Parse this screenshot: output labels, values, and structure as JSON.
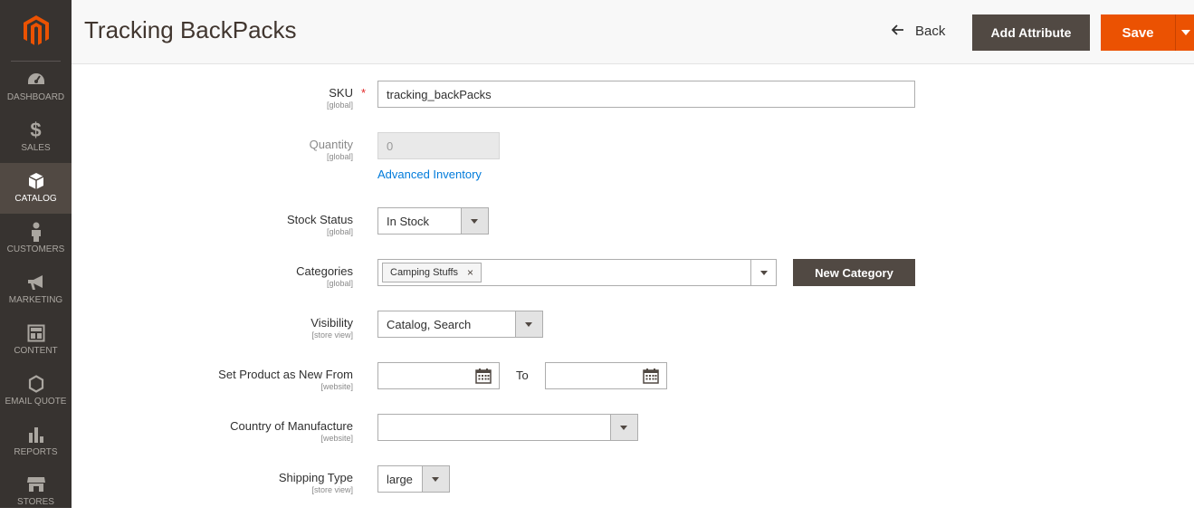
{
  "nav": {
    "items": [
      {
        "label": "DASHBOARD",
        "icon": "dashboard-icon"
      },
      {
        "label": "SALES",
        "icon": "dollar-icon"
      },
      {
        "label": "CATALOG",
        "icon": "box-icon"
      },
      {
        "label": "CUSTOMERS",
        "icon": "person-icon"
      },
      {
        "label": "MARKETING",
        "icon": "megaphone-icon"
      },
      {
        "label": "CONTENT",
        "icon": "layout-icon"
      },
      {
        "label": "EMAIL QUOTE",
        "icon": "hexagon-icon"
      },
      {
        "label": "REPORTS",
        "icon": "bar-chart-icon"
      },
      {
        "label": "STORES",
        "icon": "store-icon"
      }
    ],
    "active": "CATALOG"
  },
  "header": {
    "title": "Tracking BackPacks",
    "back_label": "Back",
    "add_attribute_label": "Add Attribute",
    "save_label": "Save"
  },
  "form": {
    "sku": {
      "label": "SKU",
      "scope": "[global]",
      "required": "*",
      "value": "tracking_backPacks"
    },
    "quantity": {
      "label": "Quantity",
      "scope": "[global]",
      "value": "0",
      "advanced_link": "Advanced Inventory"
    },
    "stock_status": {
      "label": "Stock Status",
      "scope": "[global]",
      "value": "In Stock"
    },
    "categories": {
      "label": "Categories",
      "scope": "[global]",
      "tag": "Camping Stuffs",
      "tag_remove": "×",
      "new_button": "New Category"
    },
    "visibility": {
      "label": "Visibility",
      "scope": "[store view]",
      "value": "Catalog, Search"
    },
    "new_from": {
      "label": "Set Product as New From",
      "scope": "[website]",
      "from_value": "",
      "to_label": "To",
      "to_value": ""
    },
    "country": {
      "label": "Country of Manufacture",
      "scope": "[website]",
      "value": ""
    },
    "shipping": {
      "label": "Shipping Type",
      "scope": "[store view]",
      "value": "large"
    }
  },
  "colors": {
    "sidebar": "#373330",
    "sidebar_active": "#514943",
    "accent": "#eb5202",
    "dark_button": "#514943",
    "link": "#007bdb"
  }
}
